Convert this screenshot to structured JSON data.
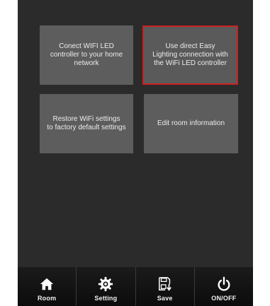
{
  "tiles": [
    {
      "label": "Conect WIFI LED\ncontroller to your home\nnetwork"
    },
    {
      "label": "Use direct Easy\nLighting connection with\nthe WiFi LED controller",
      "selected": true
    },
    {
      "label": "Restore WiFi settings\nto factory default settings"
    },
    {
      "label": "Edit room information"
    }
  ],
  "nav": [
    {
      "label": "Room",
      "icon": "home-icon"
    },
    {
      "label": "Setting",
      "icon": "gear-icon"
    },
    {
      "label": "Save",
      "icon": "save-icon"
    },
    {
      "label": "ON/OFF",
      "icon": "power-icon"
    }
  ],
  "colors": {
    "screen_bg": "#2b2b2b",
    "tile_bg": "#5d5d5d",
    "selected_border": "#cc1f1f",
    "nav_bg": "#111111"
  }
}
